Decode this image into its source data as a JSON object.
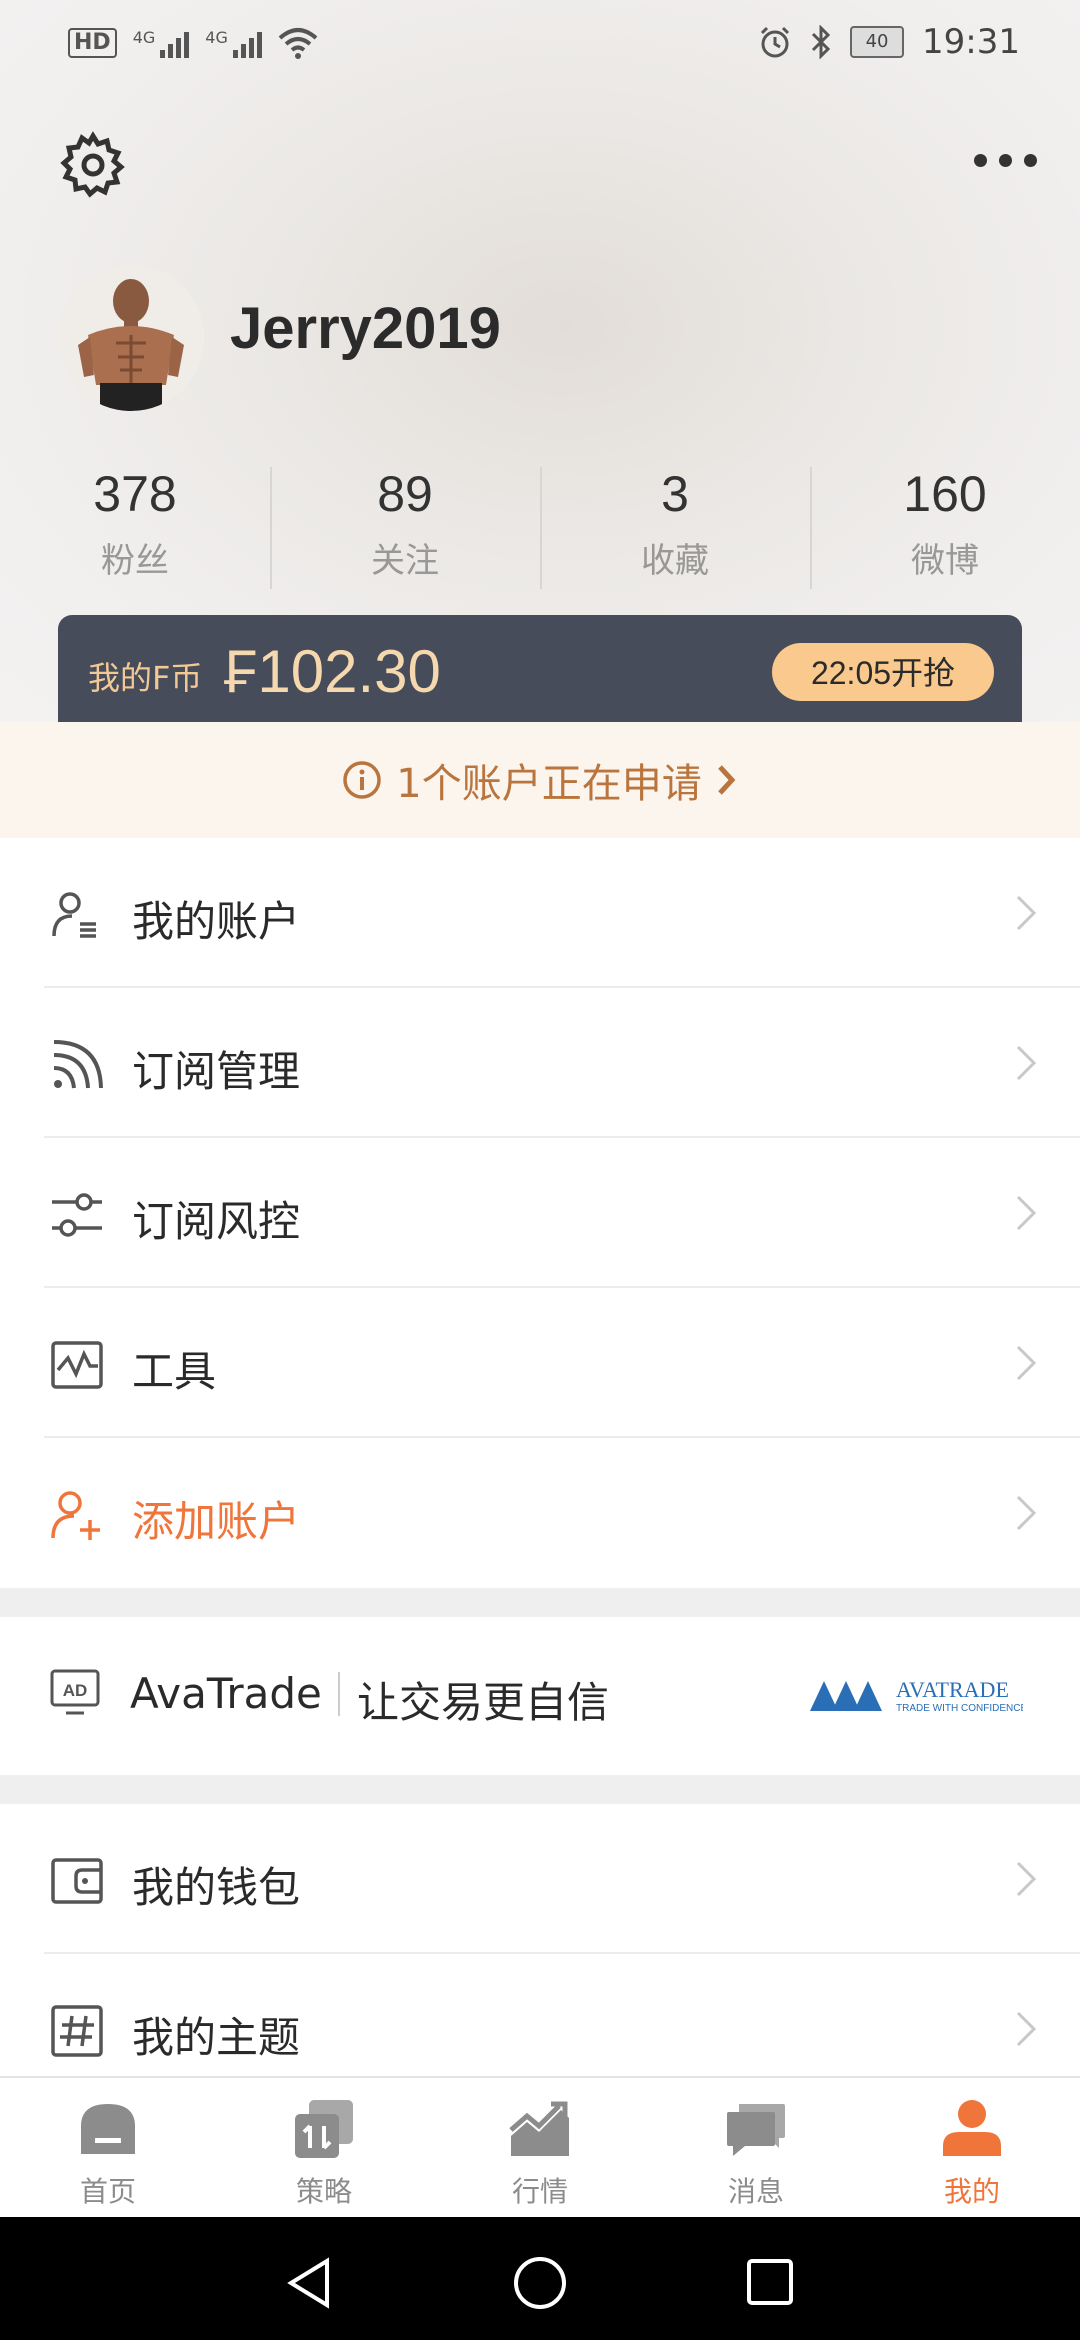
{
  "status_bar": {
    "hd": "HD",
    "net1": "4G",
    "net2": "4G",
    "battery": "40",
    "time": "19:31"
  },
  "profile": {
    "username": "Jerry2019"
  },
  "stats": [
    {
      "value": "378",
      "label": "粉丝"
    },
    {
      "value": "89",
      "label": "关注"
    },
    {
      "value": "3",
      "label": "收藏"
    },
    {
      "value": "160",
      "label": "微博"
    }
  ],
  "coin": {
    "label": "我的F币",
    "value": "₣102.30",
    "button": "22:05开抢"
  },
  "notice": {
    "text": "1个账户正在申请"
  },
  "menu": [
    {
      "label": "我的账户",
      "icon": "account-icon"
    },
    {
      "label": "订阅管理",
      "icon": "rss-icon"
    },
    {
      "label": "订阅风控",
      "icon": "sliders-icon"
    },
    {
      "label": "工具",
      "icon": "chart-tool-icon"
    },
    {
      "label": "添加账户",
      "icon": "add-user-icon"
    }
  ],
  "ad": {
    "badge": "AD",
    "brand": "AvaTrade",
    "slogan": "让交易更自信",
    "logo_text": "AVATRADE",
    "logo_sub": "TRADE WITH CONFIDENCE"
  },
  "menu2": [
    {
      "label": "我的钱包",
      "icon": "wallet-icon"
    },
    {
      "label": "我的主题",
      "icon": "hashtag-icon"
    }
  ],
  "tabs": [
    {
      "label": "首页",
      "icon": "home-icon"
    },
    {
      "label": "策略",
      "icon": "strategy-icon"
    },
    {
      "label": "行情",
      "icon": "market-icon"
    },
    {
      "label": "消息",
      "icon": "message-icon"
    },
    {
      "label": "我的",
      "icon": "profile-icon",
      "active": true
    }
  ],
  "colors": {
    "accent": "#f0753a",
    "coin_card": "#464c5a",
    "coin_text": "#f6d8ae",
    "coin_button": "#f9c98d",
    "notice_bg": "#fbf5ee",
    "notice_text": "#b9753d"
  }
}
